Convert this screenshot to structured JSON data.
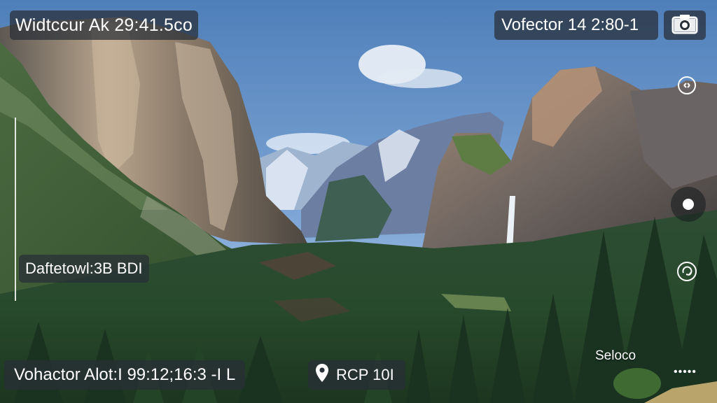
{
  "overlay": {
    "top_left_text": "Widtccur Ak 29:41.5co",
    "top_right_text": "Vofector 14 2:80-1",
    "mid_left_text": "Daftetowl:3B BDI",
    "bottom_left_text": "Vohactor Alot:I 99:12;16:3 -I L",
    "location_text": "RCP 10I",
    "select_text": "Seloco",
    "more_text": "•••••"
  },
  "icons": {
    "camera": "camera-icon",
    "location": "location-pin-icon",
    "top_side": "focus-ring-icon",
    "record": "record-icon",
    "bottom_side": "rotate-icon"
  },
  "colors": {
    "overlay_bg": "#282e36",
    "text": "#ffffff",
    "sky": "#6f9bd0",
    "forest": "#2c4a2f"
  }
}
